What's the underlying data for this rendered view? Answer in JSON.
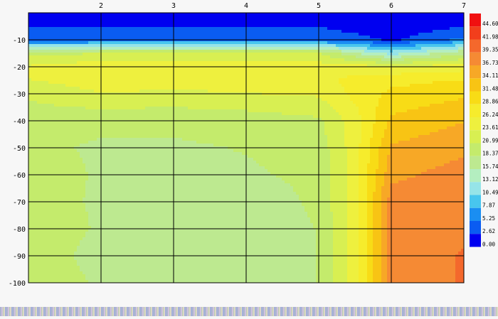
{
  "chart_data": {
    "type": "heatmap",
    "title": "",
    "xlabel": "",
    "ylabel": "",
    "xlim": [
      1,
      7
    ],
    "ylim": [
      -100,
      0
    ],
    "x_ticks": [
      "2",
      "3",
      "4",
      "5",
      "6",
      "7"
    ],
    "x_tick_values": [
      2,
      3,
      4,
      5,
      6,
      7
    ],
    "y_ticks": [
      "-10",
      "-20",
      "-30",
      "-40",
      "-50",
      "-60",
      "-70",
      "-80",
      "-90",
      "-100"
    ],
    "y_tick_values": [
      -10,
      -20,
      -30,
      -40,
      -50,
      -60,
      -70,
      -80,
      -90,
      -100
    ],
    "gridlines_x": [
      2,
      3,
      4,
      5,
      6
    ],
    "gridlines_y": [
      -10,
      -20,
      -30,
      -40,
      -50,
      -60,
      -70,
      -80,
      -90
    ],
    "colorbar": {
      "labels": [
        "44.60",
        "41.98",
        "39.35",
        "36.73",
        "34.11",
        "31.48",
        "28.86",
        "26.24",
        "23.61",
        "20.99",
        "18.37",
        "15.74",
        "13.12",
        "10.49",
        "7.87",
        "5.25",
        "2.62",
        "0.00"
      ],
      "colors": [
        "#f01010",
        "#f23e1c",
        "#f4682c",
        "#f58a34",
        "#f7a826",
        "#f8c414",
        "#f8dc16",
        "#f6ec2c",
        "#eef03e",
        "#d8ef52",
        "#c4eb6c",
        "#bde990",
        "#b4eec0",
        "#96e4e8",
        "#48c6ee",
        "#1a8ef2",
        "#0a5cf2",
        "#0000f0"
      ]
    },
    "x": [
      1,
      2,
      3,
      4,
      5,
      5.5,
      6,
      7
    ],
    "y": [
      0,
      -5,
      -10,
      -15,
      -20,
      -25,
      -30,
      -40,
      -50,
      -60,
      -70,
      -80,
      -90,
      -100
    ],
    "values": [
      [
        2.6,
        2.6,
        2.6,
        2.6,
        2.6,
        1.0,
        0.0,
        2.6
      ],
      [
        2.6,
        2.6,
        2.6,
        2.6,
        2.6,
        1.0,
        0.5,
        2.6
      ],
      [
        4.0,
        4.5,
        5.0,
        5.0,
        5.0,
        4.0,
        2.0,
        6.0
      ],
      [
        20.0,
        21.0,
        21.0,
        21.0,
        21.0,
        16.0,
        12.0,
        18.0
      ],
      [
        24.0,
        25.5,
        26.2,
        26.0,
        25.0,
        25.0,
        24.0,
        25.0
      ],
      [
        23.5,
        25.0,
        25.0,
        25.0,
        25.5,
        27.0,
        28.0,
        29.0
      ],
      [
        21.5,
        23.5,
        23.0,
        23.5,
        24.0,
        27.0,
        29.5,
        31.0
      ],
      [
        19.5,
        19.0,
        19.0,
        19.5,
        20.5,
        25.0,
        32.0,
        34.0
      ],
      [
        19.0,
        18.0,
        18.0,
        18.5,
        19.5,
        25.0,
        34.5,
        36.0
      ],
      [
        20.0,
        18.0,
        18.0,
        18.0,
        19.0,
        25.0,
        36.0,
        38.0
      ],
      [
        19.5,
        18.0,
        17.5,
        16.5,
        19.0,
        25.0,
        38.0,
        39.0
      ],
      [
        20.5,
        18.0,
        17.0,
        16.0,
        18.5,
        25.0,
        38.0,
        39.0
      ],
      [
        20.5,
        17.0,
        16.5,
        16.0,
        18.5,
        25.0,
        38.0,
        39.5
      ],
      [
        20.5,
        18.0,
        16.5,
        16.0,
        18.5,
        25.0,
        38.0,
        39.5
      ]
    ]
  }
}
